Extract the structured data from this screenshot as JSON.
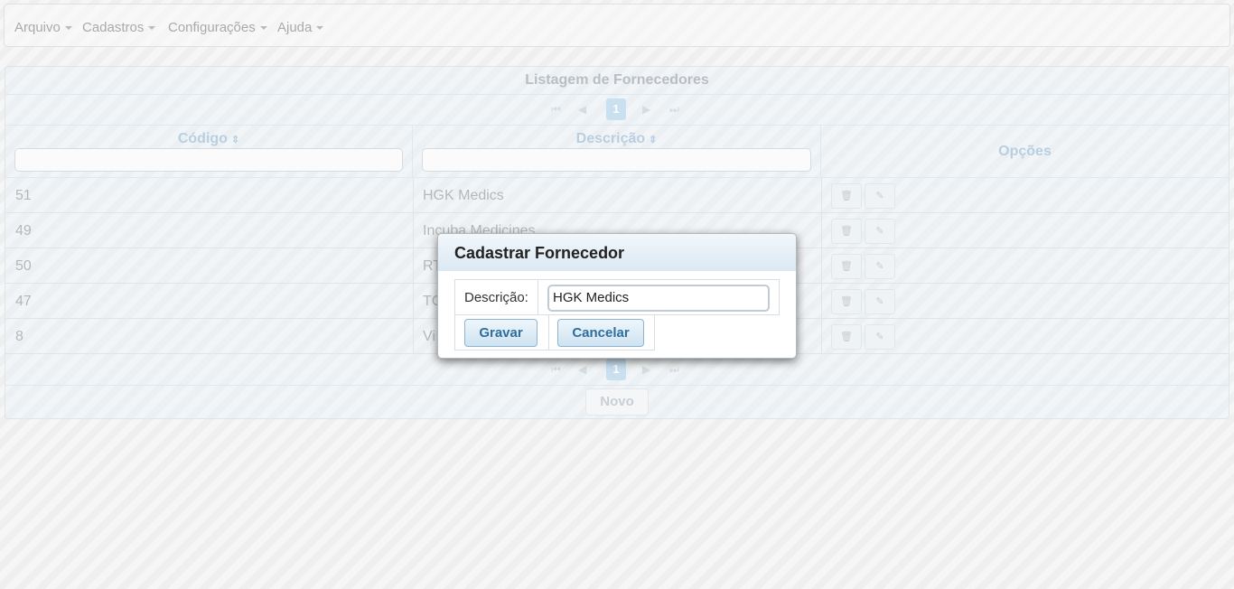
{
  "menu": {
    "items": [
      {
        "label": "Arquivo"
      },
      {
        "label": "Cadastros"
      },
      {
        "label": "Configurações"
      },
      {
        "label": "Ajuda"
      }
    ]
  },
  "panel": {
    "title": "Listagem de Fornecedores",
    "current_page": "1",
    "columns": {
      "codigo": "Código",
      "descricao": "Descrição",
      "opcoes": "Opções"
    },
    "rows": [
      {
        "codigo": "51",
        "descricao": "HGK Medics"
      },
      {
        "codigo": "49",
        "descricao": "Incuba Medicines"
      },
      {
        "codigo": "50",
        "descricao": "RT"
      },
      {
        "codigo": "47",
        "descricao": "TC"
      },
      {
        "codigo": "8",
        "descricao": "Vi"
      }
    ],
    "new_button": "Novo"
  },
  "dialog": {
    "title": "Cadastrar Fornecedor",
    "field_label": "Descrição:",
    "field_value": "HGK Medics",
    "save_button": "Gravar",
    "cancel_button": "Cancelar"
  },
  "colors": {
    "accent": "#2e6e9e",
    "header_text": "#b8cfe2"
  }
}
